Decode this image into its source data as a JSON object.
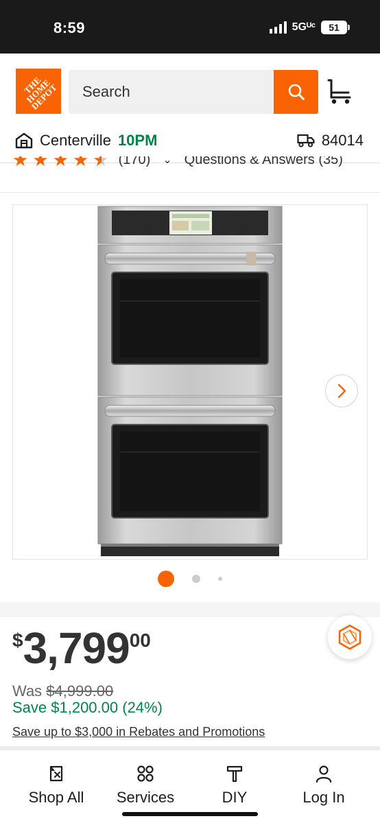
{
  "status_bar": {
    "time": "8:59",
    "network": "5Gᵁᶜ",
    "battery": "51"
  },
  "header": {
    "logo_text": "THE HOME DEPOT",
    "search_placeholder": "Search",
    "store": {
      "name": "Centerville",
      "hours": "10PM"
    },
    "zip": "84014"
  },
  "ratings": {
    "stars": 4.5,
    "count": "(170)",
    "qa_label": "Questions & Answers (35)"
  },
  "gallery": {
    "image_count": 3,
    "active_index": 0
  },
  "price": {
    "currency": "$",
    "dollars": "3,799",
    "cents": "00",
    "was_label": "Was",
    "was_price": "$4,999.00",
    "save": "Save $1,200.00 (24%)",
    "rebate_link": "Save up to $3,000 in Rebates and Promotions"
  },
  "bottom_nav": {
    "items": [
      {
        "label": "Shop All",
        "icon": "shop-all-icon"
      },
      {
        "label": "Services",
        "icon": "services-icon"
      },
      {
        "label": "DIY",
        "icon": "diy-icon"
      },
      {
        "label": "Log In",
        "icon": "user-icon"
      }
    ]
  },
  "colors": {
    "brand_orange": "#f96302",
    "success_green": "#00854a"
  }
}
